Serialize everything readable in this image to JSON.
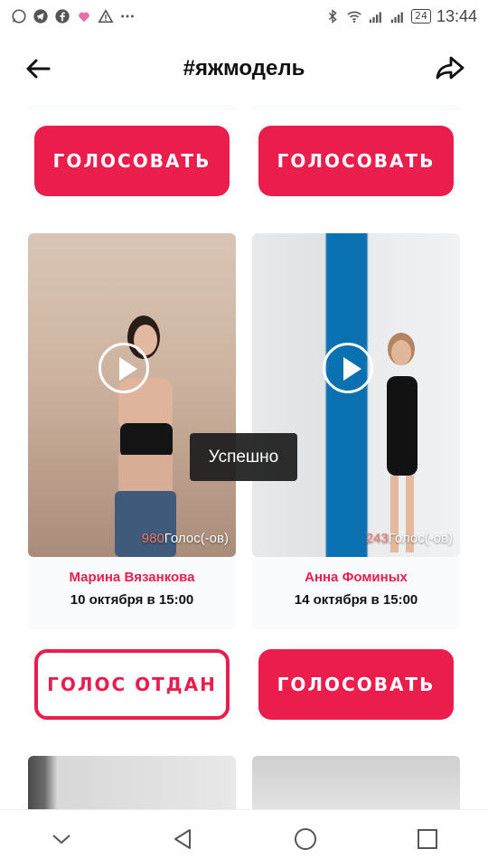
{
  "status_bar": {
    "time": "13:44",
    "battery": "24",
    "left_icons": [
      "whatsapp-icon",
      "telegram-icon",
      "facebook-icon",
      "heart-app-icon",
      "warning-icon",
      "more-icon"
    ],
    "right_icons": [
      "bluetooth-icon",
      "wifi-icon",
      "signal-icon",
      "signal-icon",
      "battery-icon"
    ]
  },
  "header": {
    "title": "#яжмодель"
  },
  "top_buttons": {
    "left": "ГОЛОСОВАТЬ",
    "right": "ГОЛОСОВАТЬ"
  },
  "toast": "Успешно",
  "cards": [
    {
      "votes_count": "980",
      "votes_label": "Голос(-ов)",
      "name": "Марина Вязанкова",
      "date": "10 октября в 15:00",
      "button": "ГОЛОС ОТДАН"
    },
    {
      "votes_count": "243",
      "votes_label": "Голос(-ов)",
      "name": "Анна Фоминых",
      "date": "14 октября в 15:00",
      "button": "ГОЛОСОВАТЬ"
    }
  ],
  "colors": {
    "accent": "#ea1d4c",
    "vote_number": "#f0766c"
  },
  "nav_icons": [
    "chevron-down-icon",
    "back-triangle-icon",
    "home-circle-icon",
    "recents-square-icon"
  ]
}
